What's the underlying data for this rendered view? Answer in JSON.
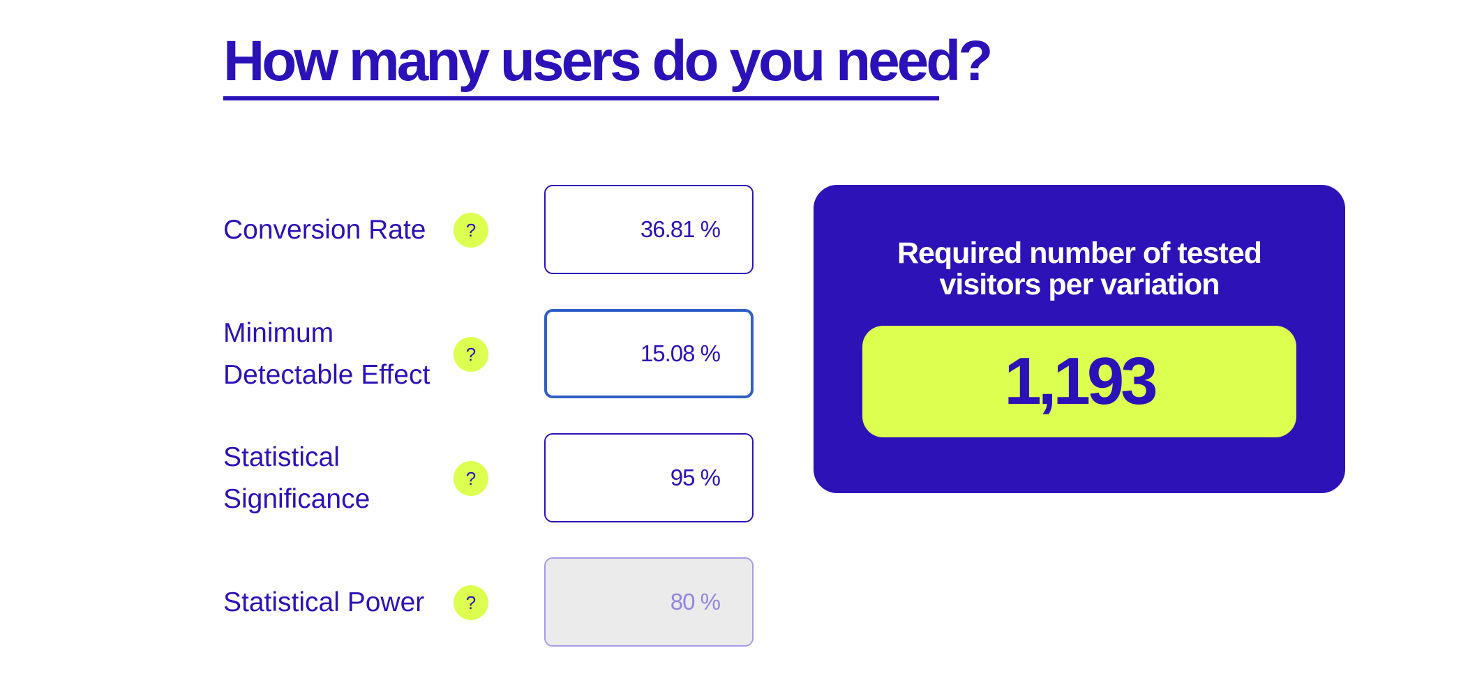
{
  "page": {
    "title": "How many users do you need?"
  },
  "fields": [
    {
      "label": "Conversion Rate",
      "value": "36.81 %",
      "help": "?"
    },
    {
      "label": "Minimum Detectable Effect",
      "value": "15.08 %",
      "help": "?"
    },
    {
      "label": "Statistical Significance",
      "value": "95 %",
      "help": "?"
    },
    {
      "label": "Statistical Power",
      "value": "80 %",
      "help": "?"
    }
  ],
  "result": {
    "heading_line1": "Required number of tested",
    "heading_line2": "visitors per variation",
    "value": "1,193"
  },
  "colors": {
    "primary": "#2b12b8",
    "accent": "#dcff50",
    "focus": "#2f5fc8",
    "disabled_bg": "#ebebeb"
  }
}
